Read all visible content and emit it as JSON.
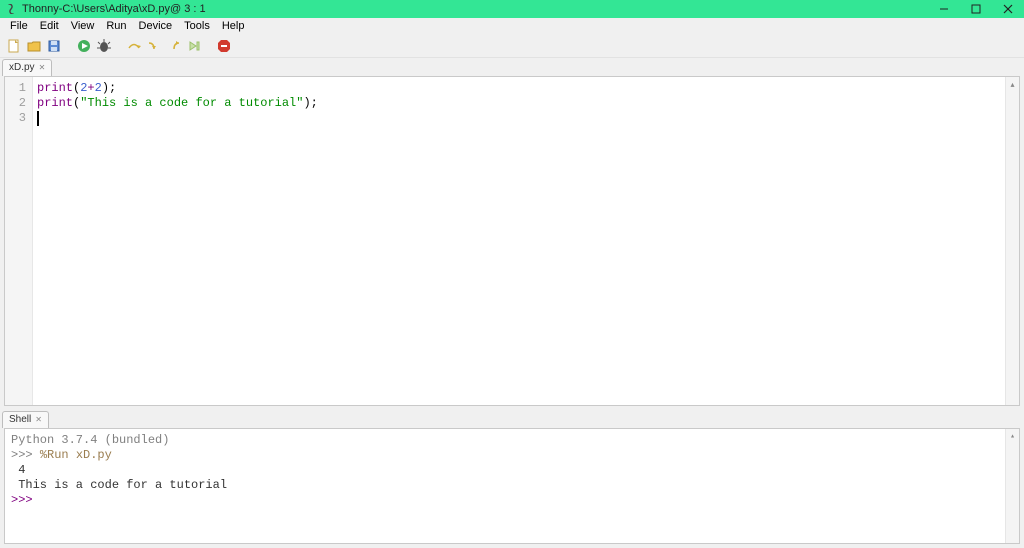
{
  "titlebar": {
    "app": "Thonny",
    "sep": "  -  ",
    "path": "C:\\Users\\Aditya\\xD.py",
    "pos": "  @  3 : 1"
  },
  "menu": {
    "file": "File",
    "edit": "Edit",
    "view": "View",
    "run": "Run",
    "device": "Device",
    "tools": "Tools",
    "help": "Help"
  },
  "toolbar_icons": {
    "new": "new-file-icon",
    "open": "open-file-icon",
    "save": "save-icon",
    "run": "run-icon",
    "debug": "debug-icon",
    "step_over": "step-over-icon",
    "step_into": "step-into-icon",
    "step_out": "step-out-icon",
    "resume": "resume-icon",
    "stop": "stop-icon"
  },
  "editor": {
    "tab_label": "xD.py",
    "gutter": [
      "1",
      "2",
      "3"
    ],
    "lines": [
      {
        "tokens": [
          {
            "t": "print",
            "cls": "tk-call"
          },
          {
            "t": "(",
            "cls": "tk-punc"
          },
          {
            "t": "2",
            "cls": "tk-num"
          },
          {
            "t": "+",
            "cls": "tk-op"
          },
          {
            "t": "2",
            "cls": "tk-num"
          },
          {
            "t": ")",
            "cls": "tk-punc"
          },
          {
            "t": ";",
            "cls": "tk-punc"
          }
        ]
      },
      {
        "tokens": [
          {
            "t": "print",
            "cls": "tk-call"
          },
          {
            "t": "(",
            "cls": "tk-punc"
          },
          {
            "t": "\"This is a code for a tutorial\"",
            "cls": "tk-str"
          },
          {
            "t": ")",
            "cls": "tk-punc"
          },
          {
            "t": ";",
            "cls": "tk-punc"
          }
        ]
      },
      {
        "tokens": [],
        "cursor": true
      }
    ]
  },
  "shell": {
    "tab_label": "Shell",
    "banner": "Python 3.7.4 (bundled)",
    "run_prompt": ">>> ",
    "run_cmd": "%Run xD.py",
    "output": [
      " 4",
      " This is a code for a tutorial"
    ],
    "ready_prompt": ">>> "
  }
}
